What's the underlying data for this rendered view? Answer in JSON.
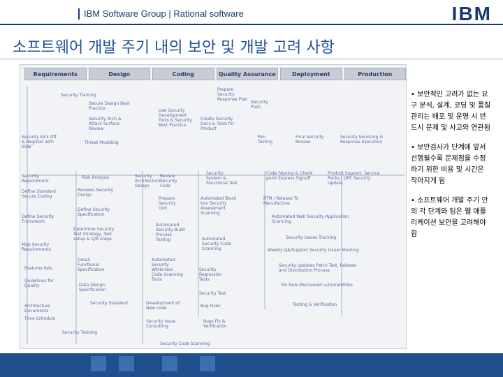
{
  "header": {
    "group": "IBM Software Group | Rational software",
    "logo": "IBM"
  },
  "title": "소프트웨어 개발 주기 내의 보안 및 개발 고려 사항",
  "phases": [
    "Requirements",
    "Design",
    "Coding",
    "Quality Assurance",
    "Deployment",
    "Production"
  ],
  "nodes": [
    "Security Training",
    "Secure Design Best Practice",
    "Security Arch & Attack Surface Review",
    "Security Kick Off & Register with SVW",
    "Threat Modeling",
    "Use Security Development Tools & Security Best Practice",
    "Prepare Security Response Plan",
    "Create Security Docs & Tools for Product",
    "Security Push",
    "Pen Testing",
    "Final Security Review",
    "Security Servicing & Response Execution",
    "Security Requirement",
    "Risk Analysis",
    "Security Architecture Design",
    "Review Security Code",
    "Security System & Functional Test",
    "Code Signing & Check point Express Signoff",
    "Product Support, Service Packs / QFE Security Update",
    "Define Standard Secure Coding",
    "Reviews Security Design",
    "Prepare Security Unit",
    "Automated Black box Security Assessment Scanning",
    "RTM / Release To Manufacture",
    "Define Security Framework",
    "Define Security Specification",
    "Automated Web Security Application Scanning",
    "Determine Security Test Strategy, Test setup & Q/A stage",
    "Automated Security Build Process Testing",
    "Automated Security Code Scanning",
    "Security Issues Tracking",
    "Weekly QA/Support Security Issuer Meeting",
    "Map Security Requirements",
    "Detail Functional Specification",
    "Features lists",
    "Automated Security White-box Code Scanning Tools",
    "Security Updates Patch Test, Release and Distribution Process",
    "Guidelines for Quality",
    "Data Design Specification",
    "Security Regression Tests",
    "Fix New discovered vulnerabilities",
    "Security Standard",
    "Security Test",
    "Architecture Documents",
    "Development of New code",
    "Bug Fixes",
    "Testing & Verification",
    "Time Schedule",
    "Security Issue Consulting",
    "Bugs Fix & Verification",
    "Security Training",
    "Security Code Scanning"
  ],
  "bullets": [
    "• 보안적인 고려가 없는 요구 분석, 설계, 코딩 및 품질관리는 배포 및 운영 시 반드시 문제 및 사고와 연관됨",
    "• 보안검사가 단계에 앞서 선행될수록 문제점을 수정하기 위한 비용 및 시간은 작아지게 됨",
    "• 소프트웨어 개발 주기 안의 각 단계와 팀은 웹 애플리케이션 보안을 고려해야 함"
  ],
  "colors": {
    "brand": "#1a3a6e",
    "title": "#1f4f9c",
    "footer": "#1f4f8c"
  }
}
